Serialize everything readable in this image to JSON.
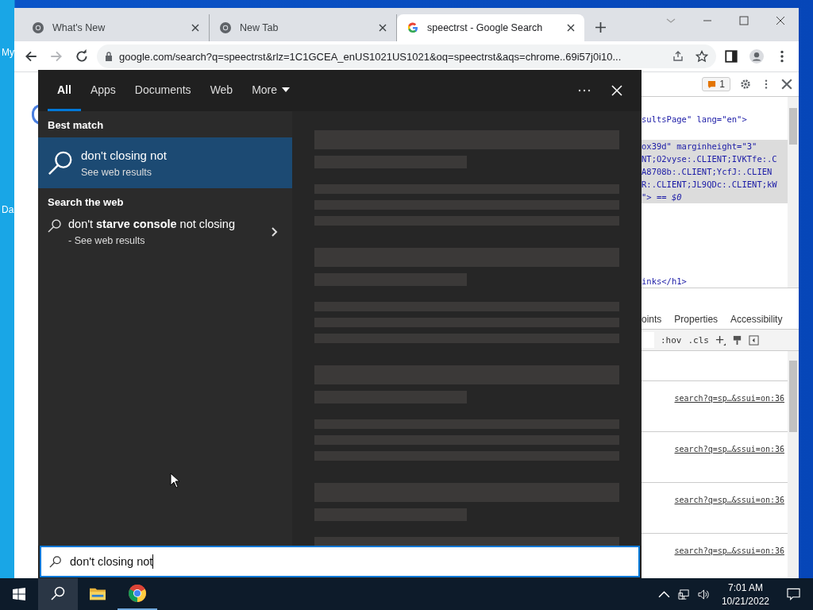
{
  "desktop": {
    "icon_labels": [
      "My",
      "Da"
    ]
  },
  "browser": {
    "tabs": [
      {
        "title": "What's New",
        "selected": false,
        "kind": "chrome"
      },
      {
        "title": "New Tab",
        "selected": false,
        "kind": "chrome"
      },
      {
        "title": "speectrst - Google Search",
        "selected": true,
        "kind": "google"
      }
    ],
    "url": "google.com/search?q=speectrst&rlz=1C1GCEA_enUS1021US1021&oq=speectrst&aqs=chrome..69i57j0i10...",
    "devtools": {
      "issues_count": "1",
      "elements_lines": [
        {
          "text": "sultsPage\" lang=\"en\">",
          "highlighted": false
        },
        {
          "kind": "blank",
          "highlighted": false
        },
        {
          "text": "ox39d\" marginheight=\"3\"",
          "highlighted": true
        },
        {
          "text": "NT;O2vyse:.CLIENT;IVKTfe:.C",
          "highlighted": true
        },
        {
          "text": "A8708b:.CLIENT;YcfJ:.CLIEN",
          "highlighted": true
        },
        {
          "text": "R:.CLIENT;JL9QDc:.CLIENT;kW",
          "highlighted": true
        },
        {
          "text": "\"> == *$0*",
          "highlighted": true
        },
        {
          "text": "inks</h1>",
          "highlighted": false
        }
      ],
      "tabs": [
        "oints",
        "Properties",
        "Accessibility"
      ],
      "style_buttons": [
        ":hov",
        ".cls"
      ],
      "rule_links": [
        "search?q=sp…&ssui=on:36",
        "search?q=sp…&ssui=on:36",
        "search?q=sp…&ssui=on:36",
        "search?q=sp…&ssui=on:36"
      ]
    }
  },
  "search_panel": {
    "tabs": [
      {
        "label": "All",
        "selected": true,
        "kind": "tab"
      },
      {
        "label": "Apps",
        "selected": false,
        "kind": "tab"
      },
      {
        "label": "Documents",
        "selected": false,
        "kind": "tab"
      },
      {
        "label": "Web",
        "selected": false,
        "kind": "tab"
      },
      {
        "label": "More",
        "selected": false,
        "kind": "dropdown"
      }
    ],
    "best_match": {
      "heading": "Best match",
      "title": "don't closing not",
      "subtitle": "See web results",
      "selected": true
    },
    "web": {
      "heading": "Search the web",
      "title": "don't **starve console** not closing",
      "subtitle": "- See web results"
    },
    "query": "don't closing not"
  },
  "taskbar": {
    "apps": [
      {
        "kind": "search",
        "highlighted": true,
        "running": false
      },
      {
        "kind": "explorer",
        "highlighted": false,
        "running": false
      },
      {
        "kind": "chrome",
        "highlighted": false,
        "running": true
      }
    ],
    "time": "7:01 AM",
    "date": "10/21/2022"
  }
}
